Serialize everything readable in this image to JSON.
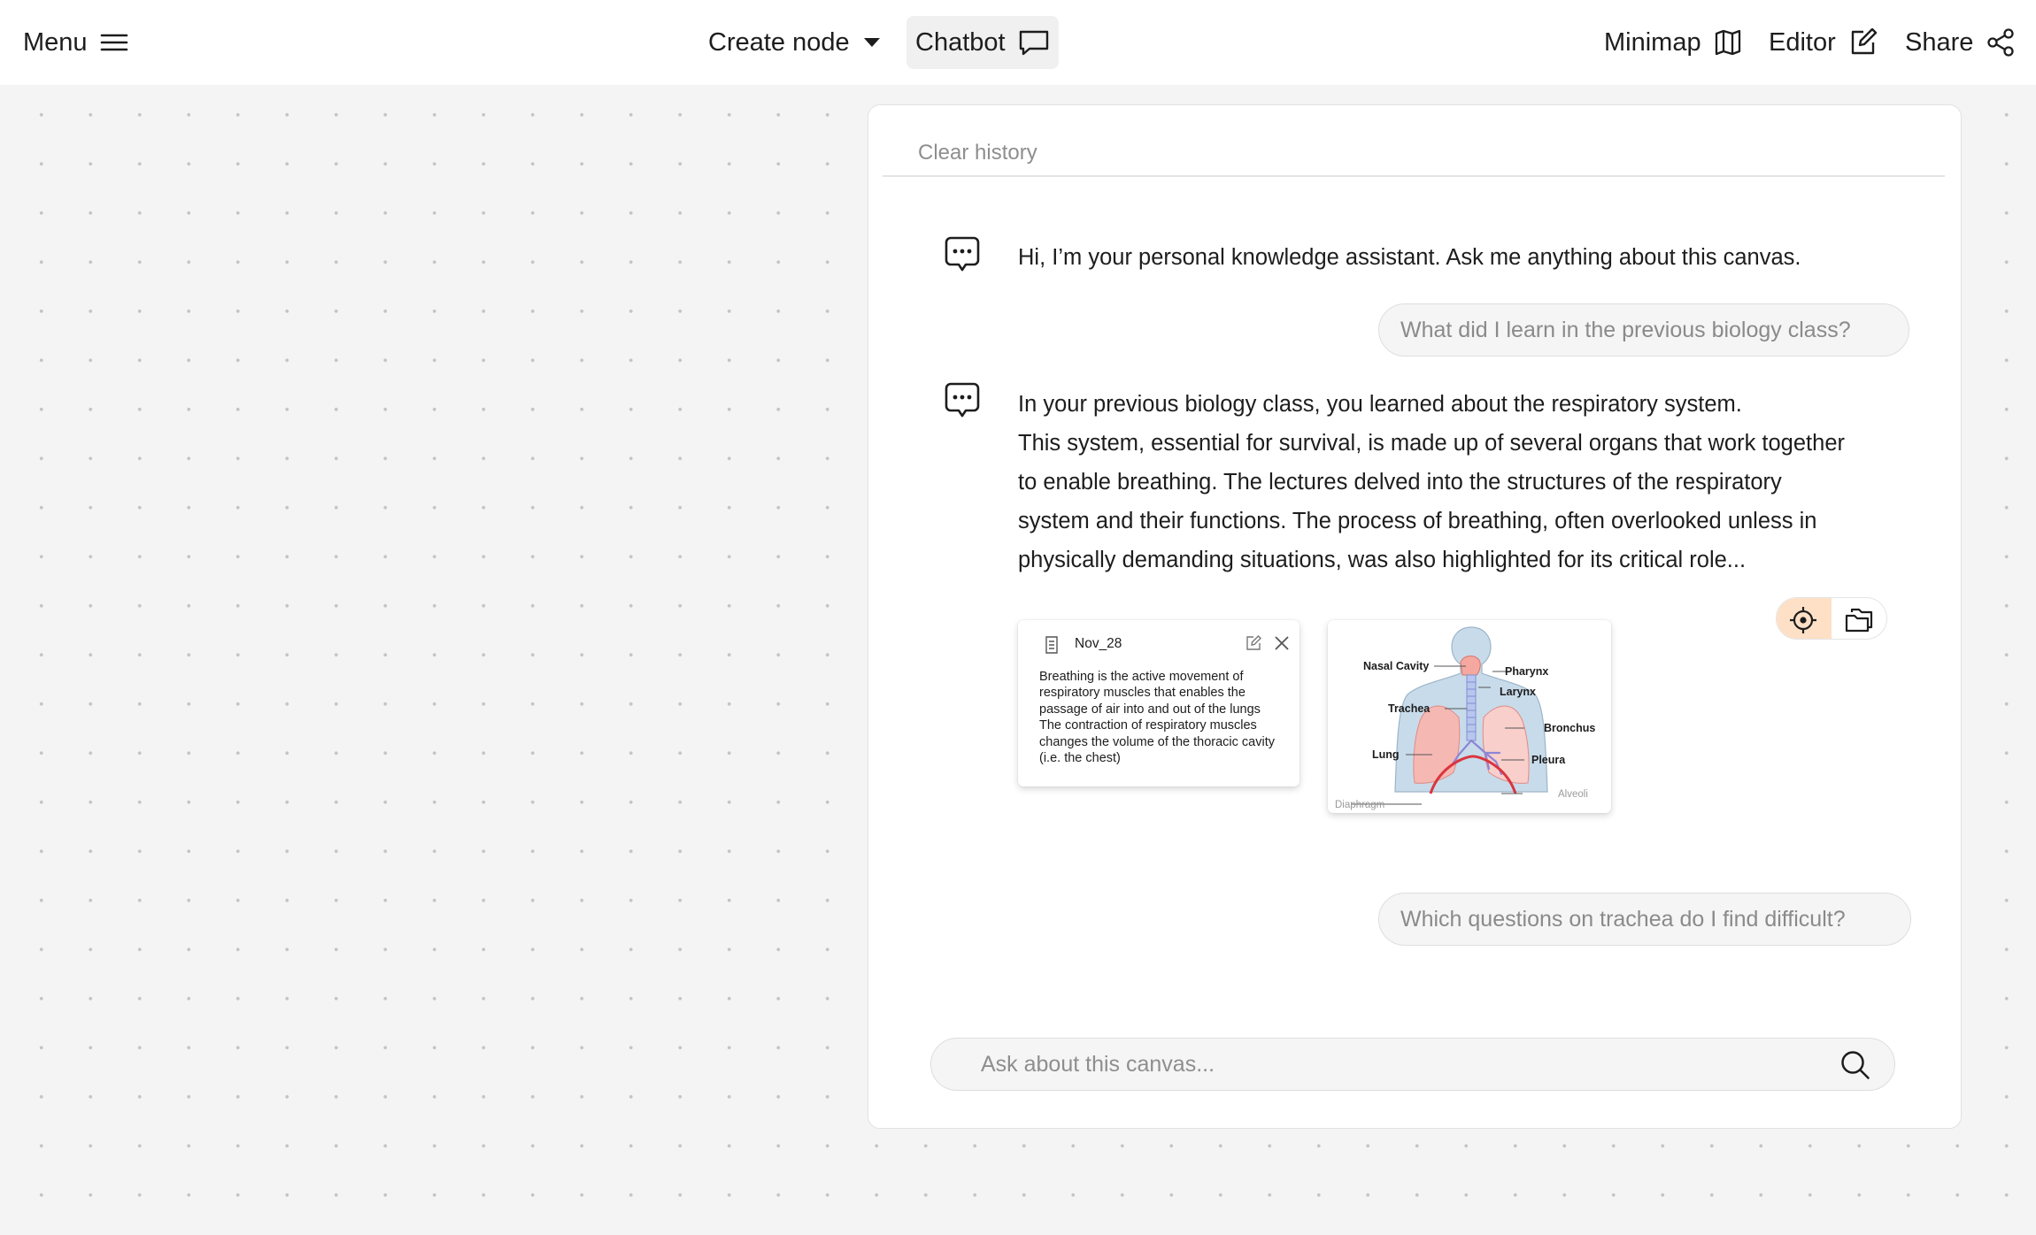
{
  "topbar": {
    "menu_label": "Menu",
    "create_node_label": "Create node",
    "chatbot_label": "Chatbot",
    "minimap_label": "Minimap",
    "editor_label": "Editor",
    "share_label": "Share"
  },
  "chat": {
    "clear_history_label": "Clear history",
    "messages": [
      {
        "role": "assistant",
        "text": "Hi, I’m your personal knowledge assistant. Ask me anything about this canvas."
      },
      {
        "role": "user",
        "text": "What did I learn in the previous biology class?"
      },
      {
        "role": "assistant",
        "lines": [
          "In your previous biology class, you learned about the respiratory system.",
          "This system, essential for survival, is made up of several organs that work together",
          "to enable breathing. The lectures delved into the structures of the respiratory",
          "system and their functions. The process of breathing, often overlooked unless in",
          "physically demanding situations, was also highlighted for its critical role..."
        ]
      },
      {
        "role": "user",
        "text": "Which questions on trachea do I find difficult?"
      }
    ],
    "note_card": {
      "title": "Nov_28",
      "body": "Breathing is the active movement of respiratory muscles that enables the passage of air into and out of the lungs\nThe contraction of respiratory muscles changes the volume of the thoracic cavity (i.e. the chest)"
    },
    "diagram_card": {
      "labels": {
        "nasal_cavity": "Nasal Cavity",
        "pharynx": "Pharynx",
        "larynx": "Larynx",
        "trachea": "Trachea",
        "bronchus": "Bronchus",
        "lung": "Lung",
        "pleura": "Pleura",
        "alveoli": "Alveoli",
        "diaphragm": "Diaphragm"
      }
    },
    "input_placeholder": "Ask about this canvas...",
    "colors": {
      "accent": "#fde0c6",
      "diaphragm": "#d9363e"
    }
  }
}
